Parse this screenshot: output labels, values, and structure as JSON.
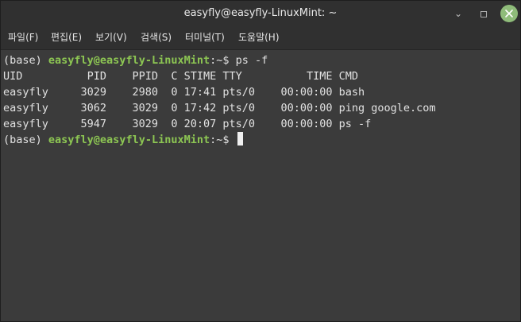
{
  "window": {
    "title": "easyfly@easyfly-LinuxMint: ~",
    "minimize_glyph": "⌄",
    "maximize_glyph": "▫",
    "close_glyph": "✕"
  },
  "menu": [
    {
      "label": "파일(F)"
    },
    {
      "label": "편집(E)"
    },
    {
      "label": "보기(V)"
    },
    {
      "label": "검색(S)"
    },
    {
      "label": "터미널(T)"
    },
    {
      "label": "도움말(H)"
    }
  ],
  "terminal": {
    "prompt1": {
      "env": "(base) ",
      "userhost": "easyfly@easyfly-LinuxMint",
      "cwd": ":~$ ",
      "command": "ps -f"
    },
    "header": "UID          PID    PPID  C STIME TTY          TIME CMD",
    "rows": [
      "easyfly     3029    2980  0 17:41 pts/0    00:00:00 bash",
      "easyfly     3062    3029  0 17:42 pts/0    00:00:00 ping google.com",
      "easyfly     5947    3029  0 20:07 pts/0    00:00:00 ps -f"
    ],
    "prompt2": {
      "env": "(base) ",
      "userhost": "easyfly@easyfly-LinuxMint",
      "cwd": ":~$ ",
      "command": ""
    }
  },
  "colors": {
    "prompt_userhost": "#8dc653",
    "close_button": "#8fbc7a",
    "terminal_bg": "#3b3b3b"
  }
}
